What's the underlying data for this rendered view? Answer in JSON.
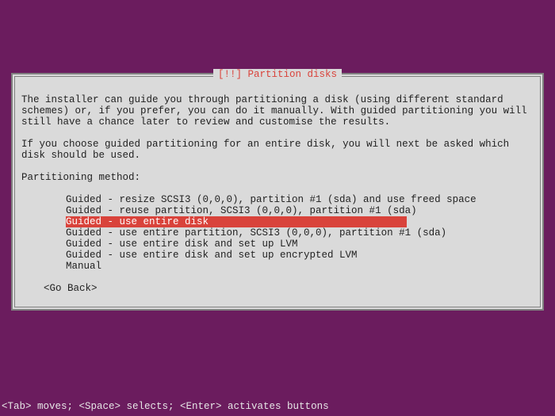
{
  "dialog": {
    "title": "[!!] Partition disks",
    "paragraph1": "The installer can guide you through partitioning a disk (using different standard schemes) or, if you prefer, you can do it manually. With guided partitioning you will still have a chance later to review and customise the results.",
    "paragraph2": "If you choose guided partitioning for an entire disk, you will next be asked which disk should be used.",
    "prompt": "Partitioning method:",
    "options": [
      "Guided - resize SCSI3 (0,0,0), partition #1 (sda) and use freed space",
      "Guided - reuse partition, SCSI3 (0,0,0), partition #1 (sda)",
      "Guided - use entire disk",
      "Guided - use entire partition, SCSI3 (0,0,0), partition #1 (sda)",
      "Guided - use entire disk and set up LVM",
      "Guided - use entire disk and set up encrypted LVM",
      "Manual"
    ],
    "selected_index": 2,
    "go_back": "<Go Back>"
  },
  "help_bar": "<Tab> moves; <Space> selects; <Enter> activates buttons"
}
